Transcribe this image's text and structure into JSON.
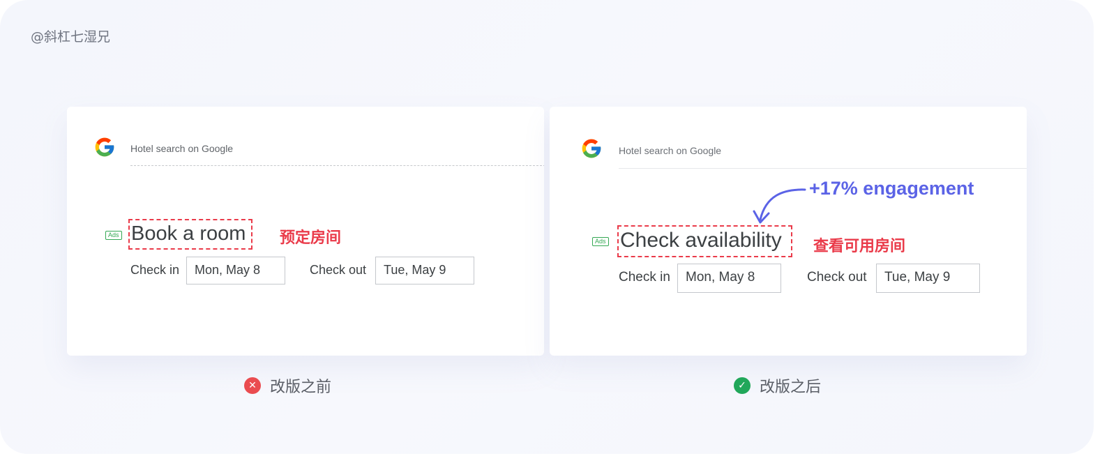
{
  "watermark": "@斜杠七湿兄",
  "before": {
    "search_label": "Hotel search on Google",
    "ads_label": "Ads",
    "headline": "Book a room",
    "headline_note_cn": "预定房间",
    "check_in_label": "Check in",
    "check_in_value": "Mon, May 8",
    "check_out_label": "Check out",
    "check_out_value": "Tue, May 9",
    "caption": "改版之前",
    "status_icon": "✕"
  },
  "after": {
    "search_label": "Hotel search on Google",
    "ads_label": "Ads",
    "headline": "Check availability",
    "headline_note_cn": "查看可用房间",
    "engagement": "+17% engagement",
    "check_in_label": "Check in",
    "check_in_value": "Mon, May 8",
    "check_out_label": "Check out",
    "check_out_value": "Tue, May 9",
    "caption": "改版之后",
    "status_icon": "✓"
  },
  "colors": {
    "highlight_red": "#ea3b4a",
    "engagement_blue": "#5b63e6",
    "ads_green": "#34a853",
    "fail_red": "#ea4c50",
    "ok_green": "#21a75a"
  },
  "icons": {
    "logo": "google-g-logo",
    "before_status": "close-circle-icon",
    "after_status": "check-circle-icon",
    "arrow": "curved-arrow-icon"
  }
}
